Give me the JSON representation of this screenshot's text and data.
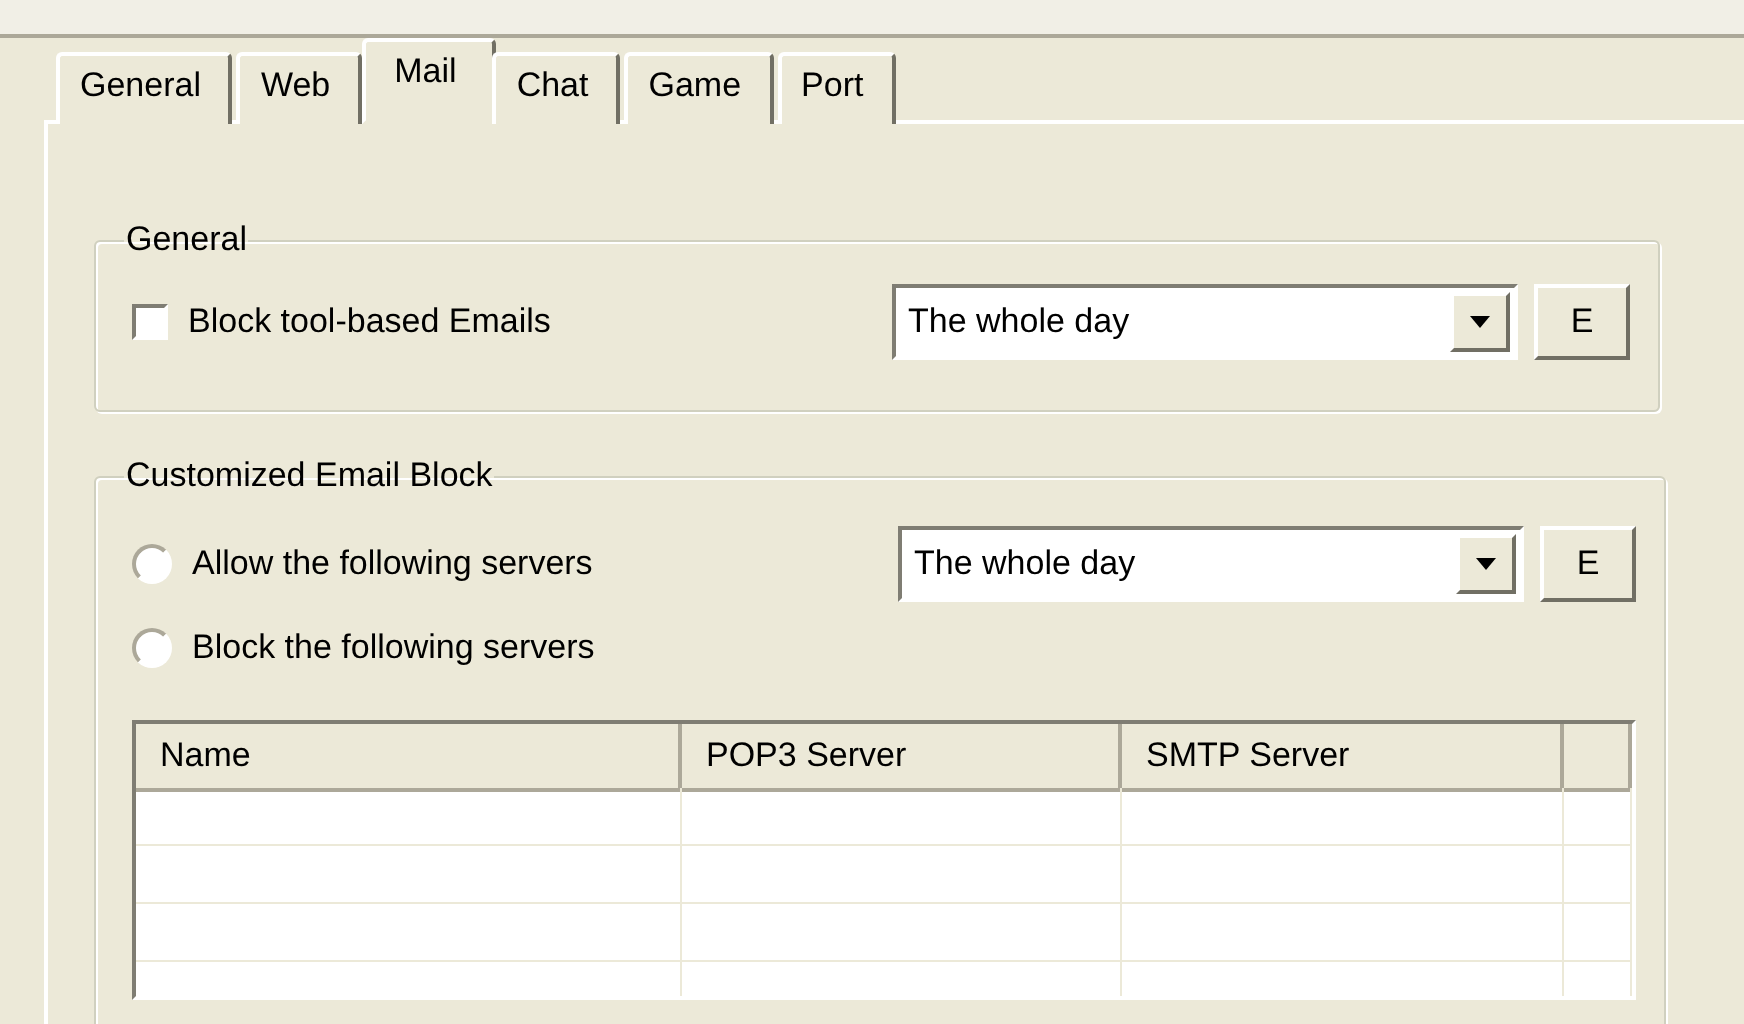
{
  "tabs": [
    {
      "label": "General",
      "selected": false
    },
    {
      "label": "Web",
      "selected": false
    },
    {
      "label": "Mail",
      "selected": true
    },
    {
      "label": "Chat",
      "selected": false
    },
    {
      "label": "Game",
      "selected": false
    },
    {
      "label": "Port",
      "selected": false
    }
  ],
  "general_group": {
    "title": "General",
    "checkbox": {
      "label": "Block tool-based Emails",
      "checked": false
    },
    "schedule": {
      "value": "The whole day"
    },
    "edit_button": "E"
  },
  "custom_group": {
    "title": "Customized Email Block",
    "options": [
      {
        "label": "Allow the following servers",
        "selected": false
      },
      {
        "label": "Block the following servers",
        "selected": false
      }
    ],
    "schedule": {
      "value": "The whole day"
    },
    "edit_button": "E",
    "table": {
      "columns": [
        "Name",
        "POP3 Server",
        "SMTP Server"
      ]
    }
  }
}
